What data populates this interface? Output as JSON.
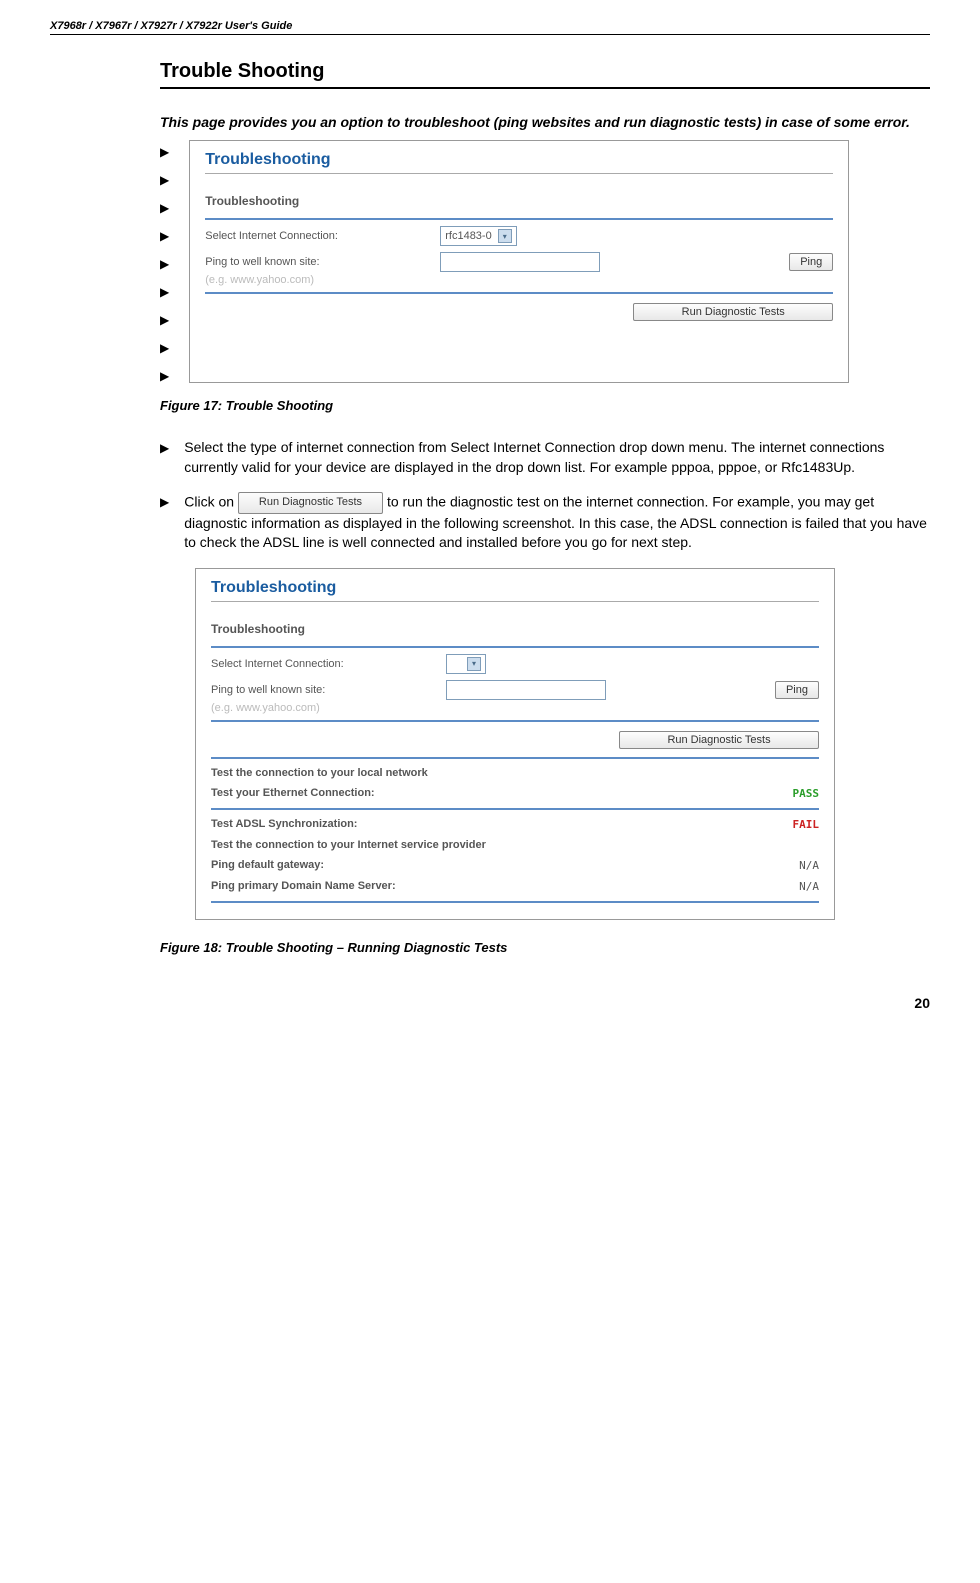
{
  "header": "X7968r / X7967r / X7927r / X7922r User's Guide",
  "section_title": "Trouble Shooting",
  "intro": "This page provides you an option to troubleshoot (ping websites and run diagnostic tests) in case of some error.",
  "screenshot1": {
    "title": "Troubleshooting",
    "subtitle": "Troubleshooting",
    "select_label": "Select Internet Connection:",
    "select_value": "rfc1483-0",
    "ping_label": "Ping to well known site:",
    "ping_hint": "(e.g. www.yahoo.com)",
    "ping_btn": "Ping",
    "diag_btn": "Run Diagnostic Tests"
  },
  "figure17": "Figure 17: Trouble Shooting",
  "bullets": [
    "Select the type of internet connection from Select Internet Connection drop down menu. The internet connections currently valid for your device are displayed in the drop down list. For example pppoa, pppoe, or Rfc1483Up."
  ],
  "bullet2_pre": "Click on ",
  "bullet2_btn": "Run Diagnostic Tests",
  "bullet2_post": " to run the diagnostic test on the internet connection.   For example, you may get diagnostic information as displayed in the following screenshot. In this case, the ADSL connection is failed that you have to check the ADSL line is well connected and installed before you go for next step.",
  "screenshot2": {
    "title": "Troubleshooting",
    "subtitle": "Troubleshooting",
    "select_label": "Select Internet Connection:",
    "ping_label": "Ping to well known site:",
    "ping_hint": "(e.g. www.yahoo.com)",
    "ping_btn": "Ping",
    "diag_btn": "Run Diagnostic Tests",
    "section1_title": "Test the connection to your local network",
    "test1_label": "Test your Ethernet Connection:",
    "test1_result": "PASS",
    "test2_label": "Test ADSL Synchronization:",
    "test2_result": "FAIL",
    "section2_title": "Test the connection to your Internet service provider",
    "test3_label": "Ping default gateway:",
    "test3_result": "N/A",
    "test4_label": "Ping primary Domain Name Server:",
    "test4_result": "N/A"
  },
  "figure18": "Figure 18: Trouble Shooting – Running Diagnostic Tests",
  "page_num": "20"
}
